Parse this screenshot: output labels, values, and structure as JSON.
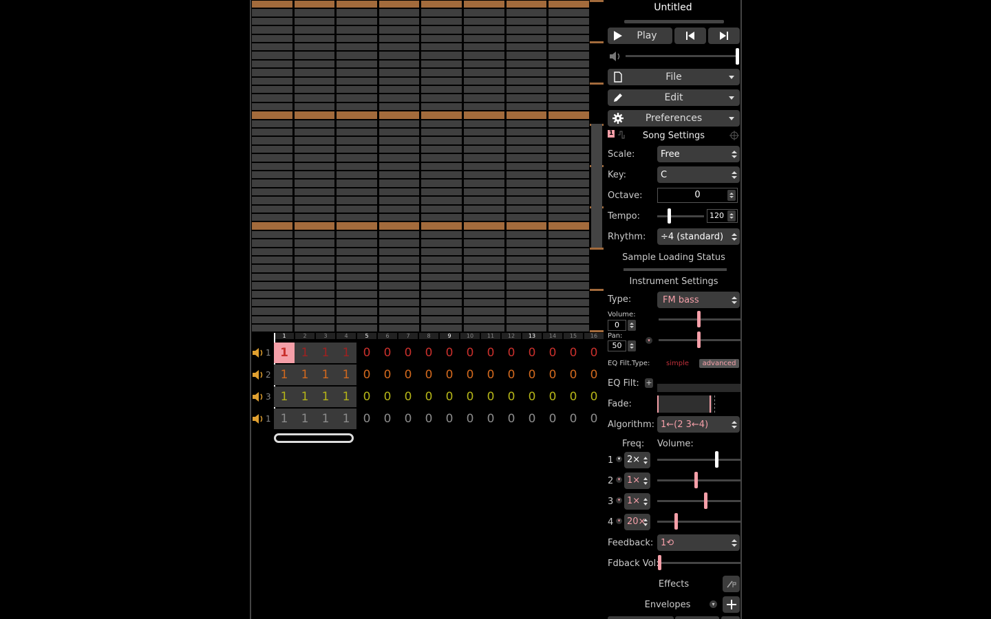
{
  "song_title": "Untitled",
  "transport": {
    "play_label": "Play"
  },
  "menus": {
    "file": "File",
    "edit": "Edit",
    "preferences": "Preferences"
  },
  "song_settings": {
    "channel_badge": "1",
    "title": "Song Settings",
    "scale_label": "Scale:",
    "scale_value": "Free",
    "key_label": "Key:",
    "key_value": "C",
    "octave_label": "Octave:",
    "octave_value": "0",
    "tempo_label": "Tempo:",
    "tempo_value": "120",
    "rhythm_label": "Rhythm:",
    "rhythm_value": "÷4 (standard)"
  },
  "sample_loading": {
    "title": "Sample Loading Status"
  },
  "instrument": {
    "title": "Instrument Settings",
    "type_label": "Type:",
    "type_value": "FM bass",
    "volume_label": "Volume:",
    "volume_value": "0",
    "pan_label": "Pan:",
    "pan_value": "50",
    "eq_filt_type_label": "EQ Filt.Type:",
    "eq_simple": "simple",
    "eq_advanced": "advanced",
    "eq_filt_label": "EQ Filt:",
    "fade_label": "Fade:",
    "algorithm_label": "Algorithm:",
    "algorithm_value": "1←(2 3←4)",
    "freq_label": "Freq:",
    "op_volume_label": "Volume:",
    "operators": [
      {
        "index": "1",
        "freq": "2×",
        "volume_level": 0.72,
        "color": "#ffffff"
      },
      {
        "index": "2",
        "freq": "1×",
        "volume_level": 0.46,
        "color": "#f59fa8"
      },
      {
        "index": "3",
        "freq": "1×",
        "volume_level": 0.58,
        "color": "#f59fa8"
      },
      {
        "index": "4",
        "freq": "20×",
        "volume_level": 0.21,
        "color": "#f59fa8"
      }
    ],
    "feedback_label": "Feedback:",
    "feedback_value": "1⟲",
    "fdback_vol_label": "Fdback Vol:",
    "effects_label": "Effects",
    "envelopes_label": "Envelopes"
  },
  "pattern": {
    "bar_numbers": [
      "1",
      "2",
      "3",
      "4",
      "5",
      "6",
      "7",
      "8",
      "9",
      "10",
      "11",
      "12",
      "13",
      "14",
      "15",
      "16"
    ],
    "channels": [
      {
        "id": "1",
        "color": "#c9302c",
        "values": [
          "1",
          "1",
          "1",
          "1",
          "0",
          "0",
          "0",
          "0",
          "0",
          "0",
          "0",
          "0",
          "0",
          "0",
          "0",
          "0"
        ]
      },
      {
        "id": "2",
        "color": "#d2691e",
        "values": [
          "1",
          "1",
          "1",
          "1",
          "0",
          "0",
          "0",
          "0",
          "0",
          "0",
          "0",
          "0",
          "0",
          "0",
          "0",
          "0"
        ]
      },
      {
        "id": "3",
        "color": "#b5b518",
        "values": [
          "1",
          "1",
          "1",
          "1",
          "0",
          "0",
          "0",
          "0",
          "0",
          "0",
          "0",
          "0",
          "0",
          "0",
          "0",
          "0"
        ]
      },
      {
        "id": "1",
        "color": "#8c8c8c",
        "values": [
          "1",
          "1",
          "1",
          "1",
          "0",
          "0",
          "0",
          "0",
          "0",
          "0",
          "0",
          "0",
          "0",
          "0",
          "0",
          "0"
        ]
      }
    ]
  },
  "colors": {
    "accent": "#f59fa8",
    "octave_line": "#a36b3c",
    "note_cell": "#3f3f3f",
    "speaker": "#e0a030"
  }
}
